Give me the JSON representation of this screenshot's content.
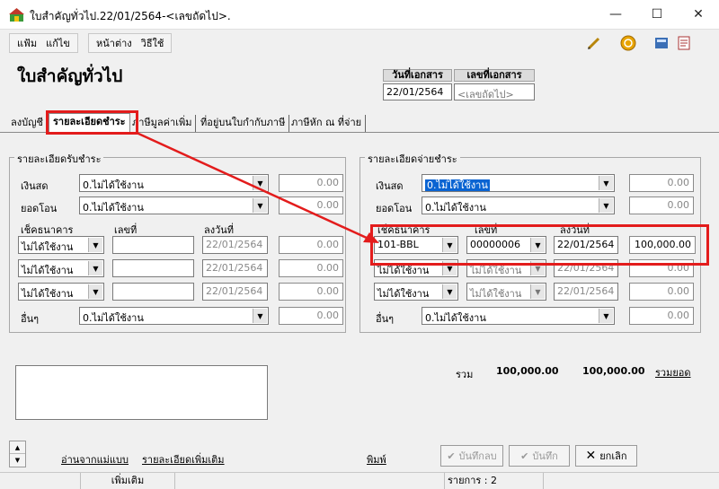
{
  "window": {
    "title": "ใบสำคัญทั่วไป.22/01/2564-<เลขถัดไป>.",
    "minimize": "—",
    "maximize": "☐",
    "close": "✕"
  },
  "menu": {
    "file": "แฟ้ม",
    "edit": "แก้ไข",
    "window": "หน้าต่าง",
    "help": "วิธีใช้"
  },
  "page_title": "ใบสำคัญทั่วไป",
  "doc": {
    "date_header": "วันที่เอกสาร",
    "number_header": "เลขที่เอกสาร",
    "date_value": "22/01/2564",
    "number_value": "<เลขถัดไป>"
  },
  "tabs": [
    {
      "label": "ลงบัญชี"
    },
    {
      "label": "รายละเอียดชำระ"
    },
    {
      "label": "ภาษีมูลค่าเพิ่ม"
    },
    {
      "label": "ที่อยู่บนใบกำกับภาษี"
    },
    {
      "label": "ภาษีหัก ณ ที่จ่าย"
    }
  ],
  "receive": {
    "title": "รายละเอียดรับชำระ",
    "cash_label": "เงินสด",
    "cash_value": "0.ไม่ได้ใช้งาน",
    "cash_amount": "0.00",
    "transfer_label": "ยอดโอน",
    "transfer_value": "0.ไม่ได้ใช้งาน",
    "transfer_amount": "0.00",
    "cheque_header": "เช็คธนาคาร",
    "no_header": "เลขที่",
    "date_header": "ลงวันที่",
    "rows": [
      {
        "bank": "ไม่ได้ใช้งาน",
        "no": "",
        "date": "22/01/2564",
        "amount": "0.00"
      },
      {
        "bank": "ไม่ได้ใช้งาน",
        "no": "",
        "date": "22/01/2564",
        "amount": "0.00"
      },
      {
        "bank": "ไม่ได้ใช้งาน",
        "no": "",
        "date": "22/01/2564",
        "amount": "0.00"
      }
    ],
    "other_label": "อื่นๆ",
    "other_value": "0.ไม่ได้ใช้งาน",
    "other_amount": "0.00"
  },
  "pay": {
    "title": "รายละเอียดจ่ายชำระ",
    "cash_label": "เงินสด",
    "cash_value": "0.ไม่ได้ใช้งาน",
    "cash_amount": "0.00",
    "transfer_label": "ยอดโอน",
    "transfer_value": "0.ไม่ได้ใช้งาน",
    "transfer_amount": "0.00",
    "cheque_header": "เช็คธนาคาร",
    "no_header": "เลขที่",
    "date_header": "ลงวันที่",
    "rows": [
      {
        "bank": "101-BBL",
        "no": "00000006",
        "date": "22/01/2564",
        "amount": "100,000.00"
      },
      {
        "bank": "ไม่ได้ใช้งาน",
        "no": "ไม่ได้ใช้งาน",
        "date": "22/01/2564",
        "amount": "0.00"
      },
      {
        "bank": "ไม่ได้ใช้งาน",
        "no": "ไม่ได้ใช้งาน",
        "date": "22/01/2564",
        "amount": "0.00"
      }
    ],
    "other_label": "อื่นๆ",
    "other_value": "0.ไม่ได้ใช้งาน",
    "other_amount": "0.00"
  },
  "totals": {
    "label": "รวม",
    "debit": "100,000.00",
    "credit": "100,000.00",
    "sum_link": "รวมยอด"
  },
  "links": {
    "read_template": "อ่านจากแม่แบบ",
    "more_details": "รายละเอียดเพิ่มเติม",
    "print": "พิมพ์"
  },
  "buttons": {
    "save_back": "บันทึกลบ",
    "save": "บันทึก",
    "cancel": "ยกเลิก"
  },
  "status": {
    "add": "เพิ่มเติม",
    "items": "รายการ : 2"
  },
  "colors": {
    "highlight": "#e31c1c",
    "selection": "#0a64d2"
  }
}
